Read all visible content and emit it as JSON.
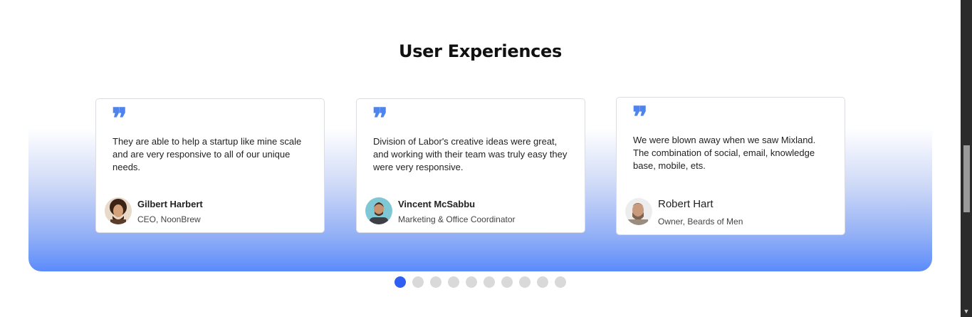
{
  "section": {
    "title": "User Experiences"
  },
  "testimonials": [
    {
      "text": "They are able to help a startup like mine scale and are very responsive to all of our unique needs.",
      "name": "Gilbert Harbert",
      "role": "CEO, NoonBrew",
      "avatar": "curly-hair-man-avatar"
    },
    {
      "text": "Division of Labor's creative ideas were great, and working with their team was truly easy they were very responsive.",
      "name": "Vincent McSabbu",
      "role": "Marketing & Office Coordinator",
      "avatar": "bald-man-avatar"
    },
    {
      "text": "We were blown away when we saw Mixland. The combination of social, email, knowledge base, mobile, ets.",
      "name": "Robert Hart",
      "role": "Owner, Beards of Men",
      "avatar": "bearded-man-avatar"
    }
  ],
  "carousel": {
    "total_dots": 10,
    "active_dot": 1
  },
  "colors": {
    "accent": "#2f5ef2",
    "quote": "#4f84ee",
    "band_bottom": "#5b8bfb"
  },
  "quote_glyph": "❞"
}
